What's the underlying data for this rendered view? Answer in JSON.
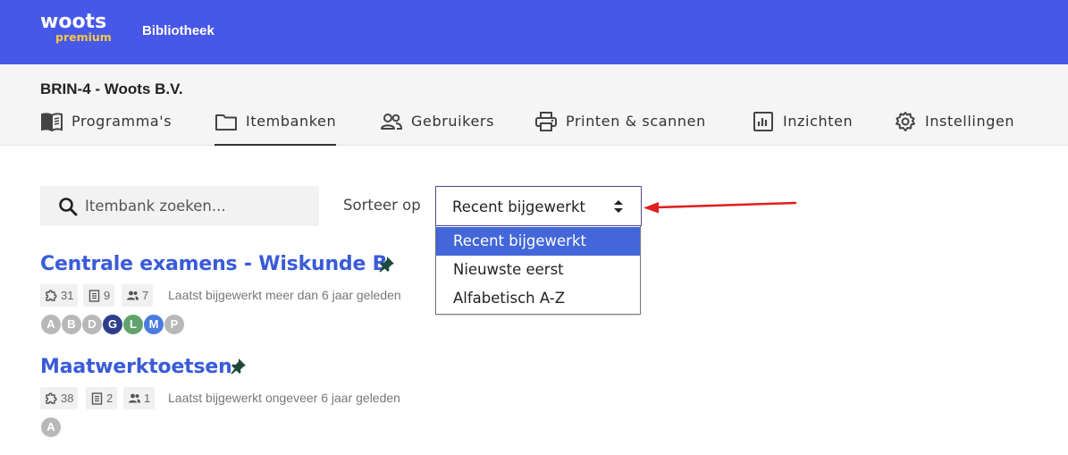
{
  "brand": {
    "name": "woots",
    "tier": "premium"
  },
  "topnav": {
    "library": "Bibliotheek"
  },
  "org": {
    "title": "BRIN-4 - Woots B.V."
  },
  "tabs": [
    {
      "label": "Programma's",
      "icon": "book-icon"
    },
    {
      "label": "Itembanken",
      "icon": "folder-icon",
      "active": true
    },
    {
      "label": "Gebruikers",
      "icon": "users-icon"
    },
    {
      "label": "Printen & scannen",
      "icon": "printer-icon"
    },
    {
      "label": "Inzichten",
      "icon": "chart-icon"
    },
    {
      "label": "Instellingen",
      "icon": "gear-icon"
    }
  ],
  "search": {
    "placeholder": "Itembank zoeken..."
  },
  "sort": {
    "label": "Sorteer op",
    "selected": "Recent bijgewerkt",
    "options": [
      "Recent bijgewerkt",
      "Nieuwste eerst",
      "Alfabetisch A-Z"
    ]
  },
  "banks": [
    {
      "title": "Centrale examens - Wiskunde B",
      "pinned": true,
      "stats": {
        "items": "31",
        "assignments": "9",
        "users": "7"
      },
      "updated": "Laatst bijgewerkt meer dan 6 jaar geleden",
      "avatars": [
        {
          "letter": "A",
          "color": "#b8b8b8"
        },
        {
          "letter": "B",
          "color": "#b8b8b8"
        },
        {
          "letter": "D",
          "color": "#b8b8b8"
        },
        {
          "letter": "G",
          "color": "#2d3f8c"
        },
        {
          "letter": "L",
          "color": "#5fa36b"
        },
        {
          "letter": "M",
          "color": "#4a7be0"
        },
        {
          "letter": "P",
          "color": "#b8b8b8"
        }
      ]
    },
    {
      "title": "Maatwerktoetsen",
      "pinned": true,
      "stats": {
        "items": "38",
        "assignments": "2",
        "users": "1"
      },
      "updated": "Laatst bijgewerkt ongeveer 6 jaar geleden",
      "avatars": [
        {
          "letter": "A",
          "color": "#b8b8b8"
        }
      ]
    }
  ],
  "colors": {
    "topbar": "#4757e8",
    "link": "#3a5bd8",
    "selected_option": "#4366d9",
    "annotation_arrow": "#e11d1d",
    "premium": "#f5c945"
  }
}
